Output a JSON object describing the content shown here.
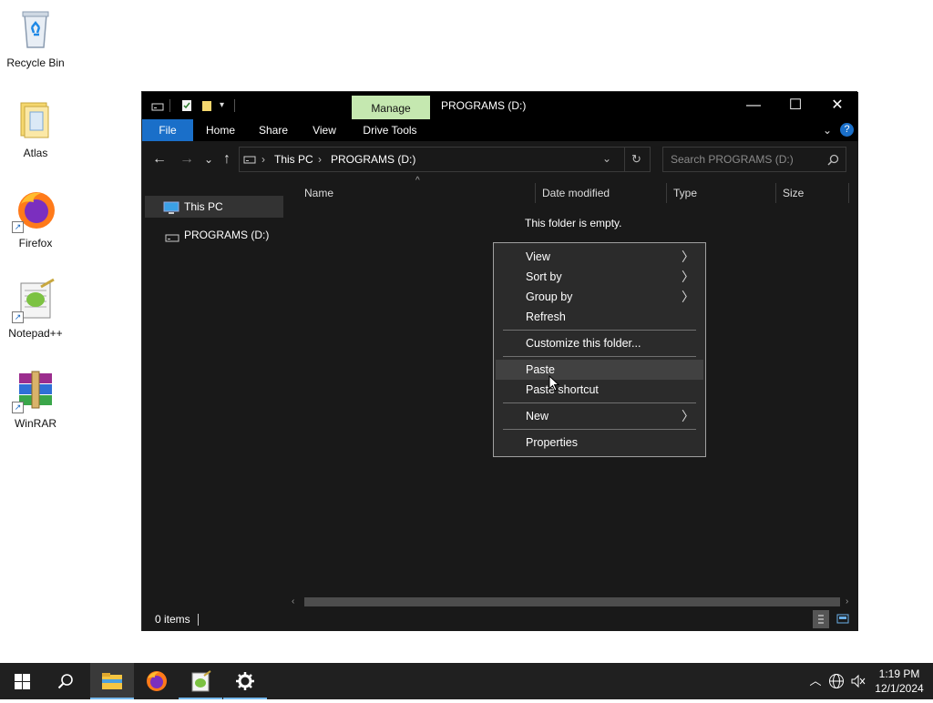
{
  "desktop": {
    "icons": [
      {
        "label": "Recycle Bin"
      },
      {
        "label": "Atlas"
      },
      {
        "label": "Firefox"
      },
      {
        "label": "Notepad++"
      },
      {
        "label": "WinRAR"
      }
    ]
  },
  "window": {
    "title": "PROGRAMS (D:)",
    "contextual_tab": "Manage",
    "tabs": [
      "File",
      "Home",
      "Share",
      "View",
      "Drive Tools"
    ],
    "controls": {
      "minimize": "—",
      "maximize": "☐",
      "close": "✕",
      "help": "?"
    },
    "nav": {
      "back": "←",
      "forward": "→",
      "recent": "⌄",
      "up": "↑"
    },
    "address": {
      "segments": [
        "This PC",
        "PROGRAMS (D:)"
      ],
      "sep": "›"
    },
    "search": {
      "placeholder": "Search PROGRAMS (D:)"
    },
    "sidebar": {
      "items": [
        "This PC",
        "PROGRAMS (D:)"
      ]
    },
    "columns": {
      "name": "Name",
      "date": "Date modified",
      "type": "Type",
      "size": "Size"
    },
    "empty_message": "This folder is empty.",
    "status": {
      "items": "0 items"
    }
  },
  "context_menu": {
    "items": [
      {
        "label": "View",
        "submenu": true
      },
      {
        "label": "Sort by",
        "submenu": true
      },
      {
        "label": "Group by",
        "submenu": true
      },
      {
        "label": "Refresh",
        "submenu": false
      },
      {
        "label": "Customize this folder...",
        "submenu": false
      },
      {
        "label": "Paste",
        "submenu": false
      },
      {
        "label": "Paste shortcut",
        "submenu": false
      },
      {
        "label": "New",
        "submenu": true
      },
      {
        "label": "Properties",
        "submenu": false
      }
    ],
    "highlighted": "Paste"
  },
  "taskbar": {
    "apps": [
      "start-icon",
      "search-icon",
      "file-explorer-icon",
      "firefox-icon",
      "notepadpp-icon",
      "settings-icon"
    ],
    "active_app": "file-explorer-icon",
    "clock": {
      "time": "1:19 PM",
      "date": "12/1/2024"
    }
  },
  "colors": {
    "accent": "#1a6fc9",
    "manage_tab": "#c5e8b0",
    "window_bg": "#191919",
    "taskbar_bg": "#202020"
  }
}
